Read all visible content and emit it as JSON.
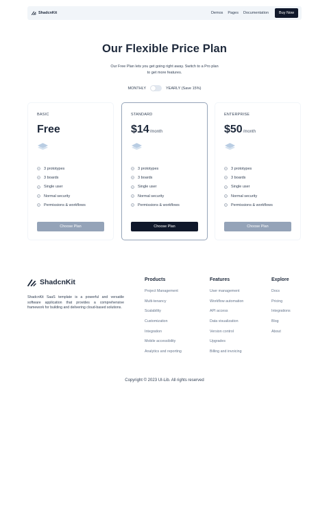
{
  "nav": {
    "brand": "ShadcnKit",
    "links": [
      "Demos",
      "Pages",
      "Documentation"
    ],
    "cta": "Buy Now"
  },
  "hero": {
    "title": "Our Flexible Price Plan",
    "subtitle": "Our Free Plan lets you get going right away. Switch to a Pro plan to get more features."
  },
  "billing": {
    "monthly_label": "MONTHLY",
    "yearly_label": "YEARLY (Save 15%)"
  },
  "plans": [
    {
      "name": "BASIC",
      "price": "Free",
      "unit": "",
      "features": [
        "3 prototypes",
        "3 boards",
        "Single user",
        "Normal security",
        "Permissions & workflows"
      ],
      "button": "Choose Plan"
    },
    {
      "name": "STANDARD",
      "price": "$14",
      "unit": "/month",
      "features": [
        "3 prototypes",
        "3 boards",
        "Single user",
        "Normal security",
        "Permissions & workflows"
      ],
      "button": "Choose Plan"
    },
    {
      "name": "ENTERPRISE",
      "price": "$50",
      "unit": "/month",
      "features": [
        "3 prototypes",
        "3 boards",
        "Single user",
        "Normal security",
        "Permissions & workflows"
      ],
      "button": "Choose Plan"
    }
  ],
  "footer": {
    "brand": "ShadcnKit",
    "description": "ShadcnKit SaaS template is a powerful and versatile software application that provides a comprehensive framework for building and delivering cloud-based solutions.",
    "columns": [
      {
        "title": "Products",
        "links": [
          "Project Management",
          "Multi-tenancy",
          "Scalability",
          "Customization",
          "Integration",
          "Mobile accessibility",
          "Analytics and reporting"
        ]
      },
      {
        "title": "Features",
        "links": [
          "User management",
          "Workflow automation",
          "API access",
          "Data visualization",
          "Version control",
          "Upgrades",
          "Billing and invoicing"
        ]
      },
      {
        "title": "Explore",
        "links": [
          "Docs",
          "Pricing",
          "Integrations",
          "Blog",
          "About"
        ]
      }
    ],
    "copyright": "Copyright © 2023 UI-Lib. All rights reserved"
  },
  "colors": {
    "primary": "#0f172a",
    "muted_button": "#94a3b8",
    "nav_background": "#f1f5f9"
  },
  "icons": {
    "brand": "logo-slash-icon",
    "feature": "check-circle-icon",
    "plan": "layers-icon"
  }
}
